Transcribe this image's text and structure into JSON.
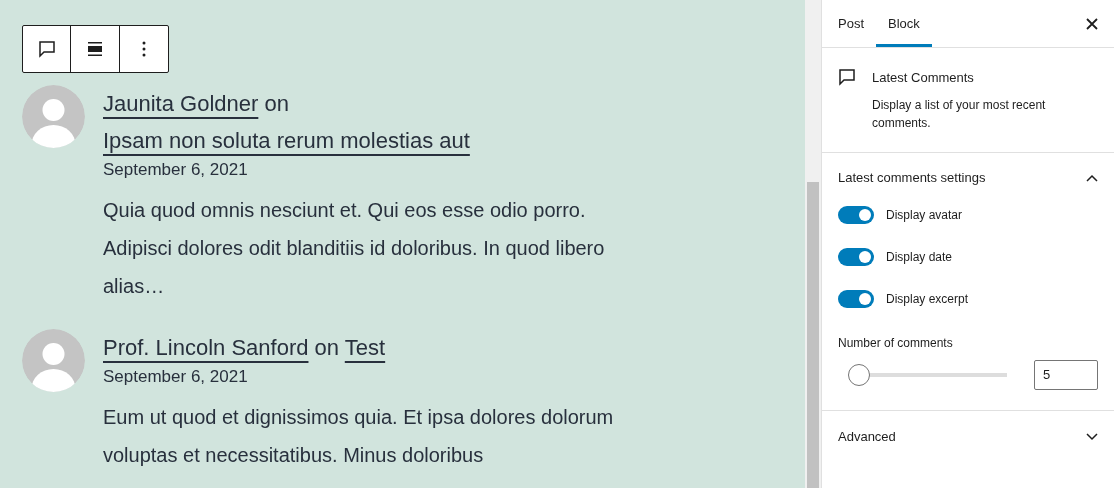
{
  "comments": [
    {
      "author": "Jaunita Goldner",
      "connector": "on",
      "post": "Ipsam non soluta rerum molestias aut",
      "date": "September 6, 2021",
      "excerpt": "Quia quod omnis nesciunt et. Qui eos esse odio porro. Adipisci dolores odit blanditiis id doloribus. In quod libero alias…"
    },
    {
      "author": "Prof. Lincoln Sanford",
      "connector": "on",
      "post": "Test",
      "date": "September 6, 2021",
      "excerpt": "Eum ut quod et dignissimos quia. Et ipsa dolores dolorum voluptas et necessitatibus. Minus doloribus"
    }
  ],
  "sidebar": {
    "tabs": [
      {
        "label": "Post",
        "selected": false
      },
      {
        "label": "Block",
        "selected": true
      }
    ],
    "block": {
      "title": "Latest Comments",
      "description": "Display a list of your most recent comments."
    },
    "settings": {
      "title": "Latest comments settings",
      "expanded": true,
      "toggles": [
        {
          "label": "Display avatar",
          "on": true
        },
        {
          "label": "Display date",
          "on": true
        },
        {
          "label": "Display excerpt",
          "on": true
        }
      ],
      "number": {
        "label": "Number of comments",
        "level": 0.04,
        "value": "5"
      }
    },
    "advanced": {
      "title": "Advanced",
      "expanded": false
    }
  }
}
